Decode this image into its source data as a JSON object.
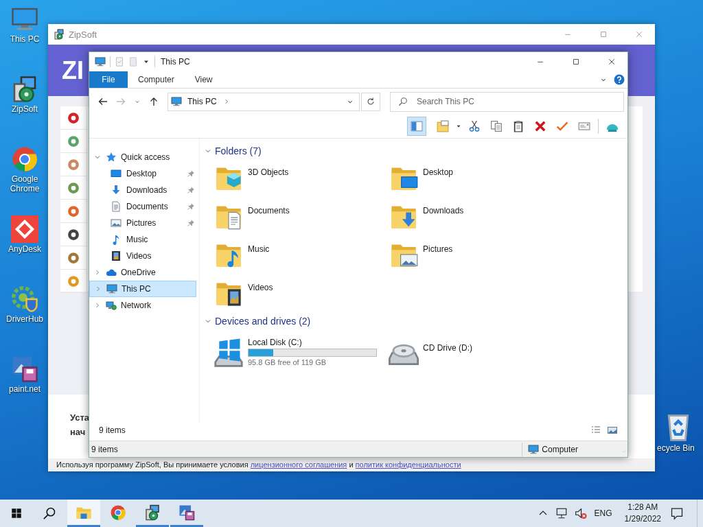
{
  "desktop": {
    "shortcuts": [
      {
        "label": "This PC"
      },
      {
        "label": "ZipSoft"
      },
      {
        "label": "Google Chrome"
      },
      {
        "label": "AnyDesk"
      },
      {
        "label": "DriverHub"
      },
      {
        "label": "paint.net"
      }
    ],
    "recycle_bin": {
      "label": "ecycle Bin"
    }
  },
  "zipsoft_window": {
    "title": "ZipSoft",
    "logo_text": "ZI",
    "install_lines": [
      "Уста",
      "нач"
    ],
    "footer": {
      "text": "Используя программу ZipSoft, Вы принимаете условия",
      "license_link": "лицензионного соглашения",
      "joiner": "и",
      "privacy_link": "политик конфиденциальности"
    }
  },
  "explorer": {
    "title": "This PC",
    "ribbon_tabs": [
      {
        "label": "File",
        "selected": true
      },
      {
        "label": "Computer",
        "selected": false
      },
      {
        "label": "View",
        "selected": false
      }
    ],
    "address": "This PC",
    "search": {
      "placeholder": "Search This PC"
    },
    "toolbar": {
      "preview_pane": true
    },
    "nav": [
      {
        "label": "Quick access",
        "expanded": true,
        "selected": false,
        "children": [
          {
            "label": "Desktop",
            "pinned": true,
            "selected": false
          },
          {
            "label": "Downloads",
            "pinned": true,
            "selected": false
          },
          {
            "label": "Documents",
            "pinned": true,
            "selected": false
          },
          {
            "label": "Pictures",
            "pinned": true,
            "selected": false
          },
          {
            "label": "Music",
            "pinned": false,
            "selected": false
          },
          {
            "label": "Videos",
            "pinned": false,
            "selected": false
          }
        ]
      },
      {
        "label": "OneDrive",
        "expanded": false,
        "selected": false
      },
      {
        "label": "This PC",
        "expanded": false,
        "selected": true
      },
      {
        "label": "Network",
        "expanded": false,
        "selected": false
      }
    ],
    "groups": [
      {
        "title": "Folders (7)",
        "expanded": true,
        "items": [
          {
            "kind": "folder",
            "label": "3D Objects"
          },
          {
            "kind": "folder",
            "label": "Desktop"
          },
          {
            "kind": "folder",
            "label": "Documents"
          },
          {
            "kind": "folder",
            "label": "Downloads"
          },
          {
            "kind": "folder",
            "label": "Music"
          },
          {
            "kind": "folder",
            "label": "Pictures"
          },
          {
            "kind": "folder",
            "label": "Videos"
          }
        ]
      },
      {
        "title": "Devices and drives (2)",
        "expanded": true,
        "items": [
          {
            "kind": "disk",
            "label": "Local Disk (C:)",
            "level": 0.195,
            "detail": "95.8 GB free of 119 GB"
          },
          {
            "kind": "cd",
            "label": "CD Drive (D:)"
          }
        ]
      }
    ],
    "inner_status": "9 items",
    "status_bar": {
      "left": "9 items",
      "right": "Computer"
    }
  },
  "taskbar": {
    "apps": [
      {
        "selected": true,
        "running": true
      },
      {
        "selected": false,
        "running": false
      },
      {
        "selected": false,
        "running": true
      },
      {
        "selected": false,
        "running": true
      }
    ],
    "tray": {
      "language": "ENG",
      "time": "1:28 AM",
      "date": "1/29/2022"
    }
  }
}
